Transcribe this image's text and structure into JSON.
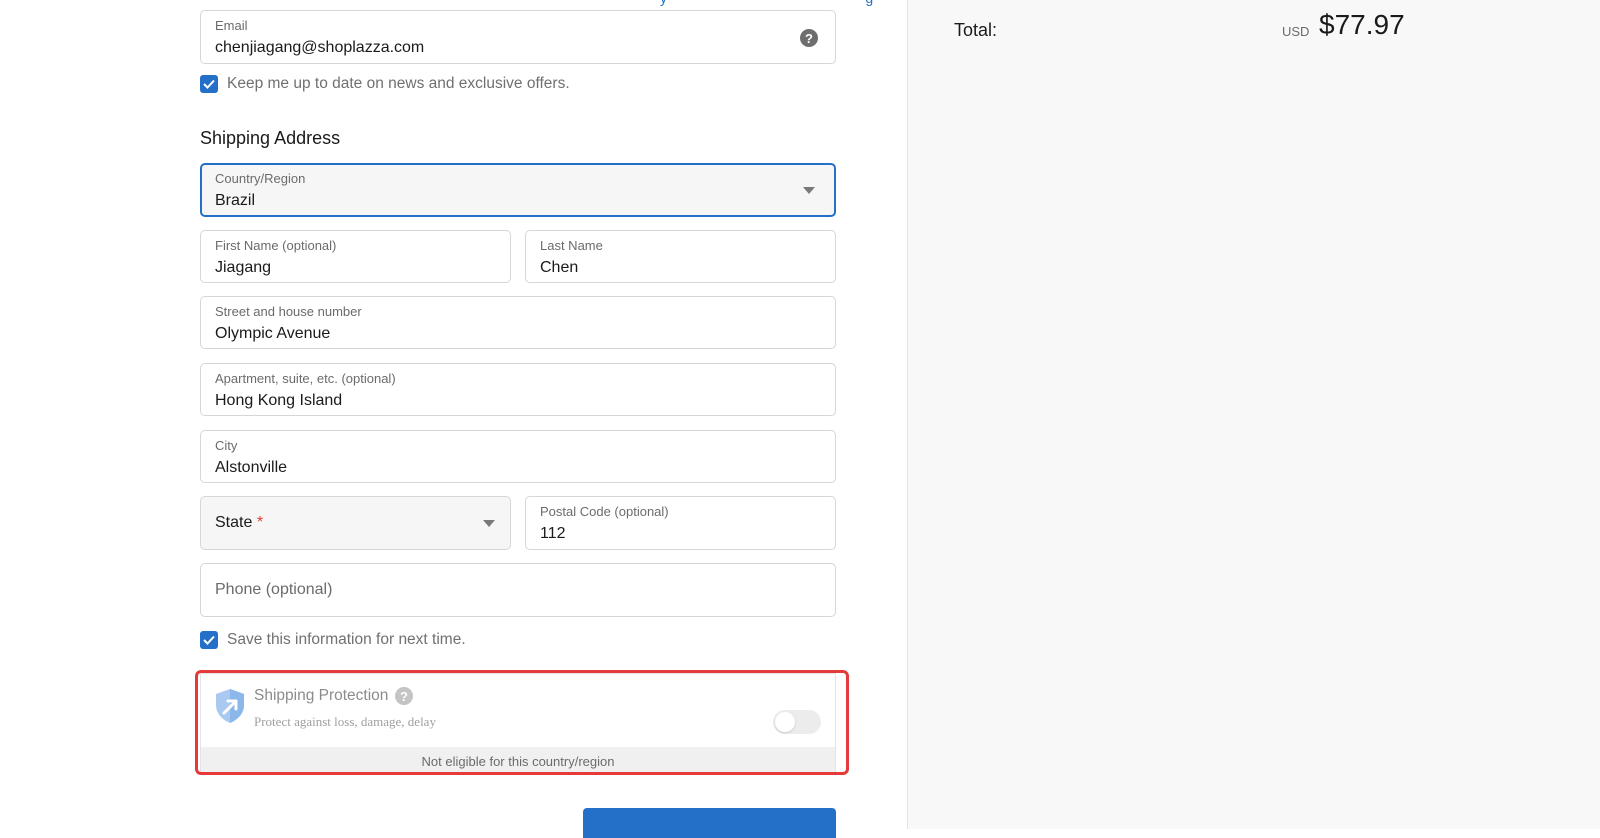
{
  "contact": {
    "email_label": "Email",
    "email_value": "chenjiagang@shoplazza.com",
    "help_glyph": "?",
    "news_checkbox_checked": true,
    "news_checkbox_label": "Keep me up to date on news and exclusive offers."
  },
  "shipping": {
    "title": "Shipping Address",
    "country": {
      "label": "Country/Region",
      "value": "Brazil"
    },
    "first_name": {
      "label": "First Name (optional)",
      "value": "Jiagang"
    },
    "last_name": {
      "label": "Last Name",
      "value": "Chen"
    },
    "street": {
      "label": "Street and house number",
      "value": "Olympic Avenue"
    },
    "apartment": {
      "label": "Apartment, suite, etc. (optional)",
      "value": "Hong Kong Island"
    },
    "city": {
      "label": "City",
      "value": "Alstonville"
    },
    "state": {
      "placeholder": "State",
      "required_mark": "*"
    },
    "postal_code": {
      "label": "Postal Code (optional)",
      "value": "112"
    },
    "phone": {
      "placeholder": "Phone (optional)"
    },
    "save_checkbox_checked": true,
    "save_checkbox_label": "Save this information for next time."
  },
  "protection": {
    "title": "Shipping Protection",
    "help_glyph": "?",
    "subtitle": "Protect against loss, damage, delay",
    "toggle_on": false,
    "notice": "Not eligible for this country/region"
  },
  "summary": {
    "total_label": "Total:",
    "currency": "USD",
    "amount": "$77.97"
  },
  "colors": {
    "accent": "#2470c9",
    "highlight_outline": "#e63a3a",
    "sidebar_bg": "#f8f8f8"
  },
  "icons": {
    "help": "help-circle-icon",
    "dropdown": "chevron-down-icon",
    "checkmark": "checkmark-icon",
    "shield": "shield-arrow-icon"
  }
}
